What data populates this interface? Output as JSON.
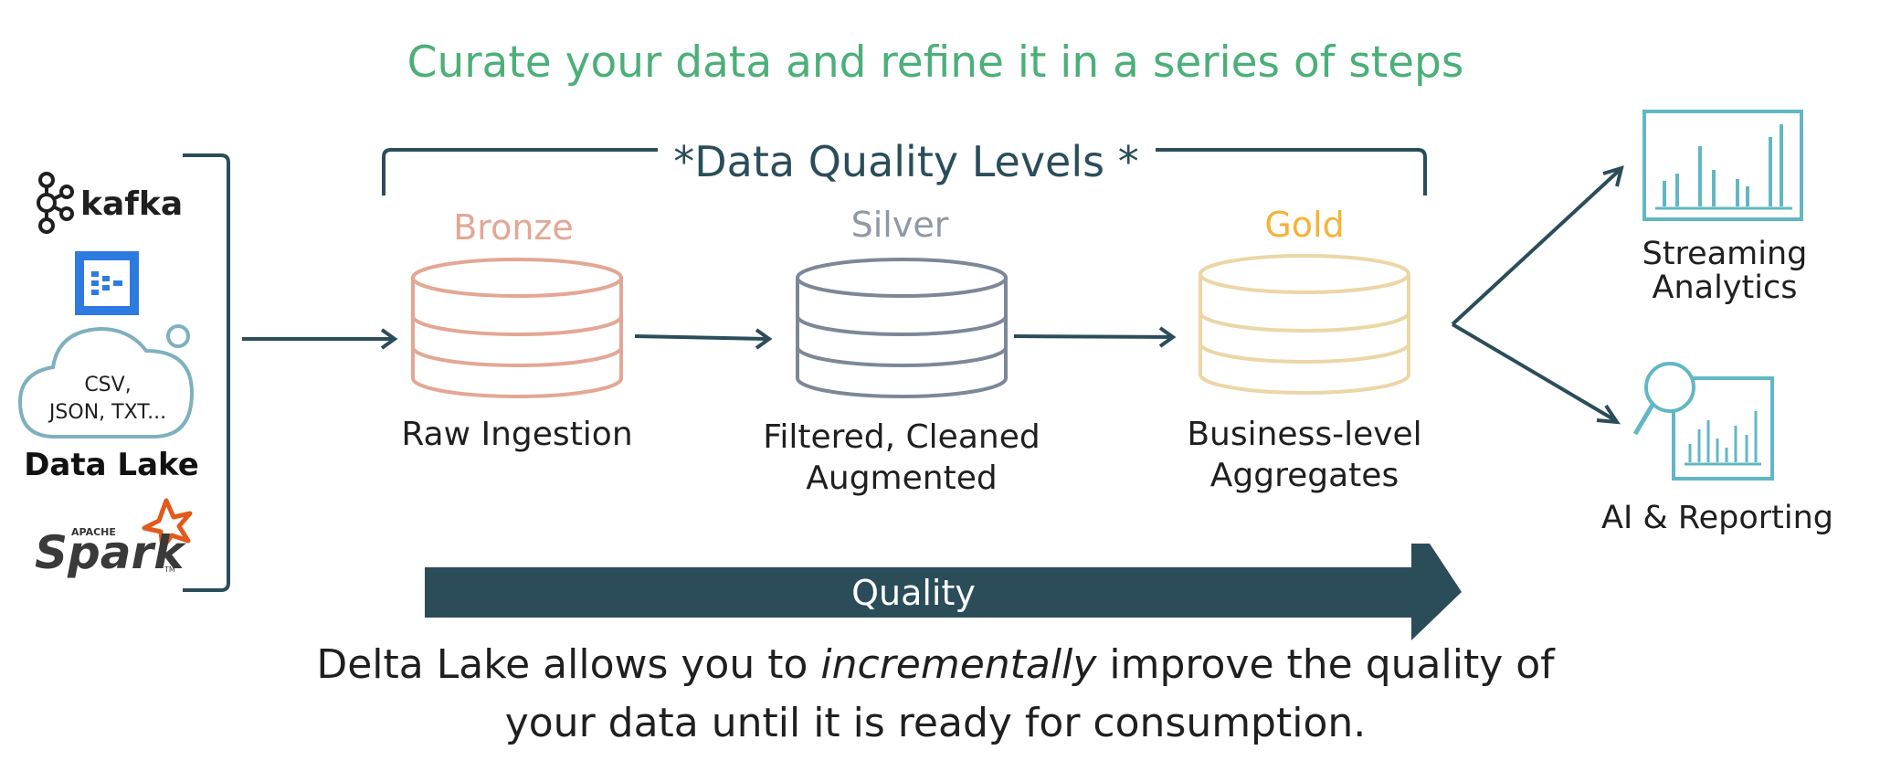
{
  "title": "Curate your data and refine it in a series of steps",
  "quality_levels_label": "*Data Quality Levels *",
  "sources": {
    "kafka": "kafka",
    "cloud_line1": "CSV,",
    "cloud_line2": "JSON, TXT...",
    "data_lake": "Data Lake",
    "spark_small": "APACHE",
    "spark": "Spark",
    "spark_tm": "TM"
  },
  "stages": [
    {
      "name": "Bronze",
      "color": "#e3a794",
      "desc_lines": [
        "Raw Ingestion"
      ]
    },
    {
      "name": "Silver",
      "color": "#7d8797",
      "desc_lines": [
        "Filtered, Cleaned",
        "Augmented"
      ]
    },
    {
      "name": "Gold",
      "color": "#f4b337",
      "desc_lines": [
        "Business-level",
        "Aggregates"
      ]
    }
  ],
  "outputs": {
    "streaming_line1": "Streaming",
    "streaming_line2": "Analytics",
    "ai_reporting": "AI & Reporting"
  },
  "quality_arrow_label": "Quality",
  "footer": {
    "line1_before": "Delta Lake allows you to ",
    "line1_em": "incrementally",
    "line1_after": " improve the quality of",
    "line2": "your data until it is ready for consumption."
  },
  "colors": {
    "title": "#4caf79",
    "dark_teal": "#2b4d5a",
    "gold_db": "#ecd6a6",
    "output_icon": "#62b7c4",
    "text": "#1f1f1f",
    "azure_blue": "#2d7be0",
    "spark_orange": "#e25a1c"
  }
}
